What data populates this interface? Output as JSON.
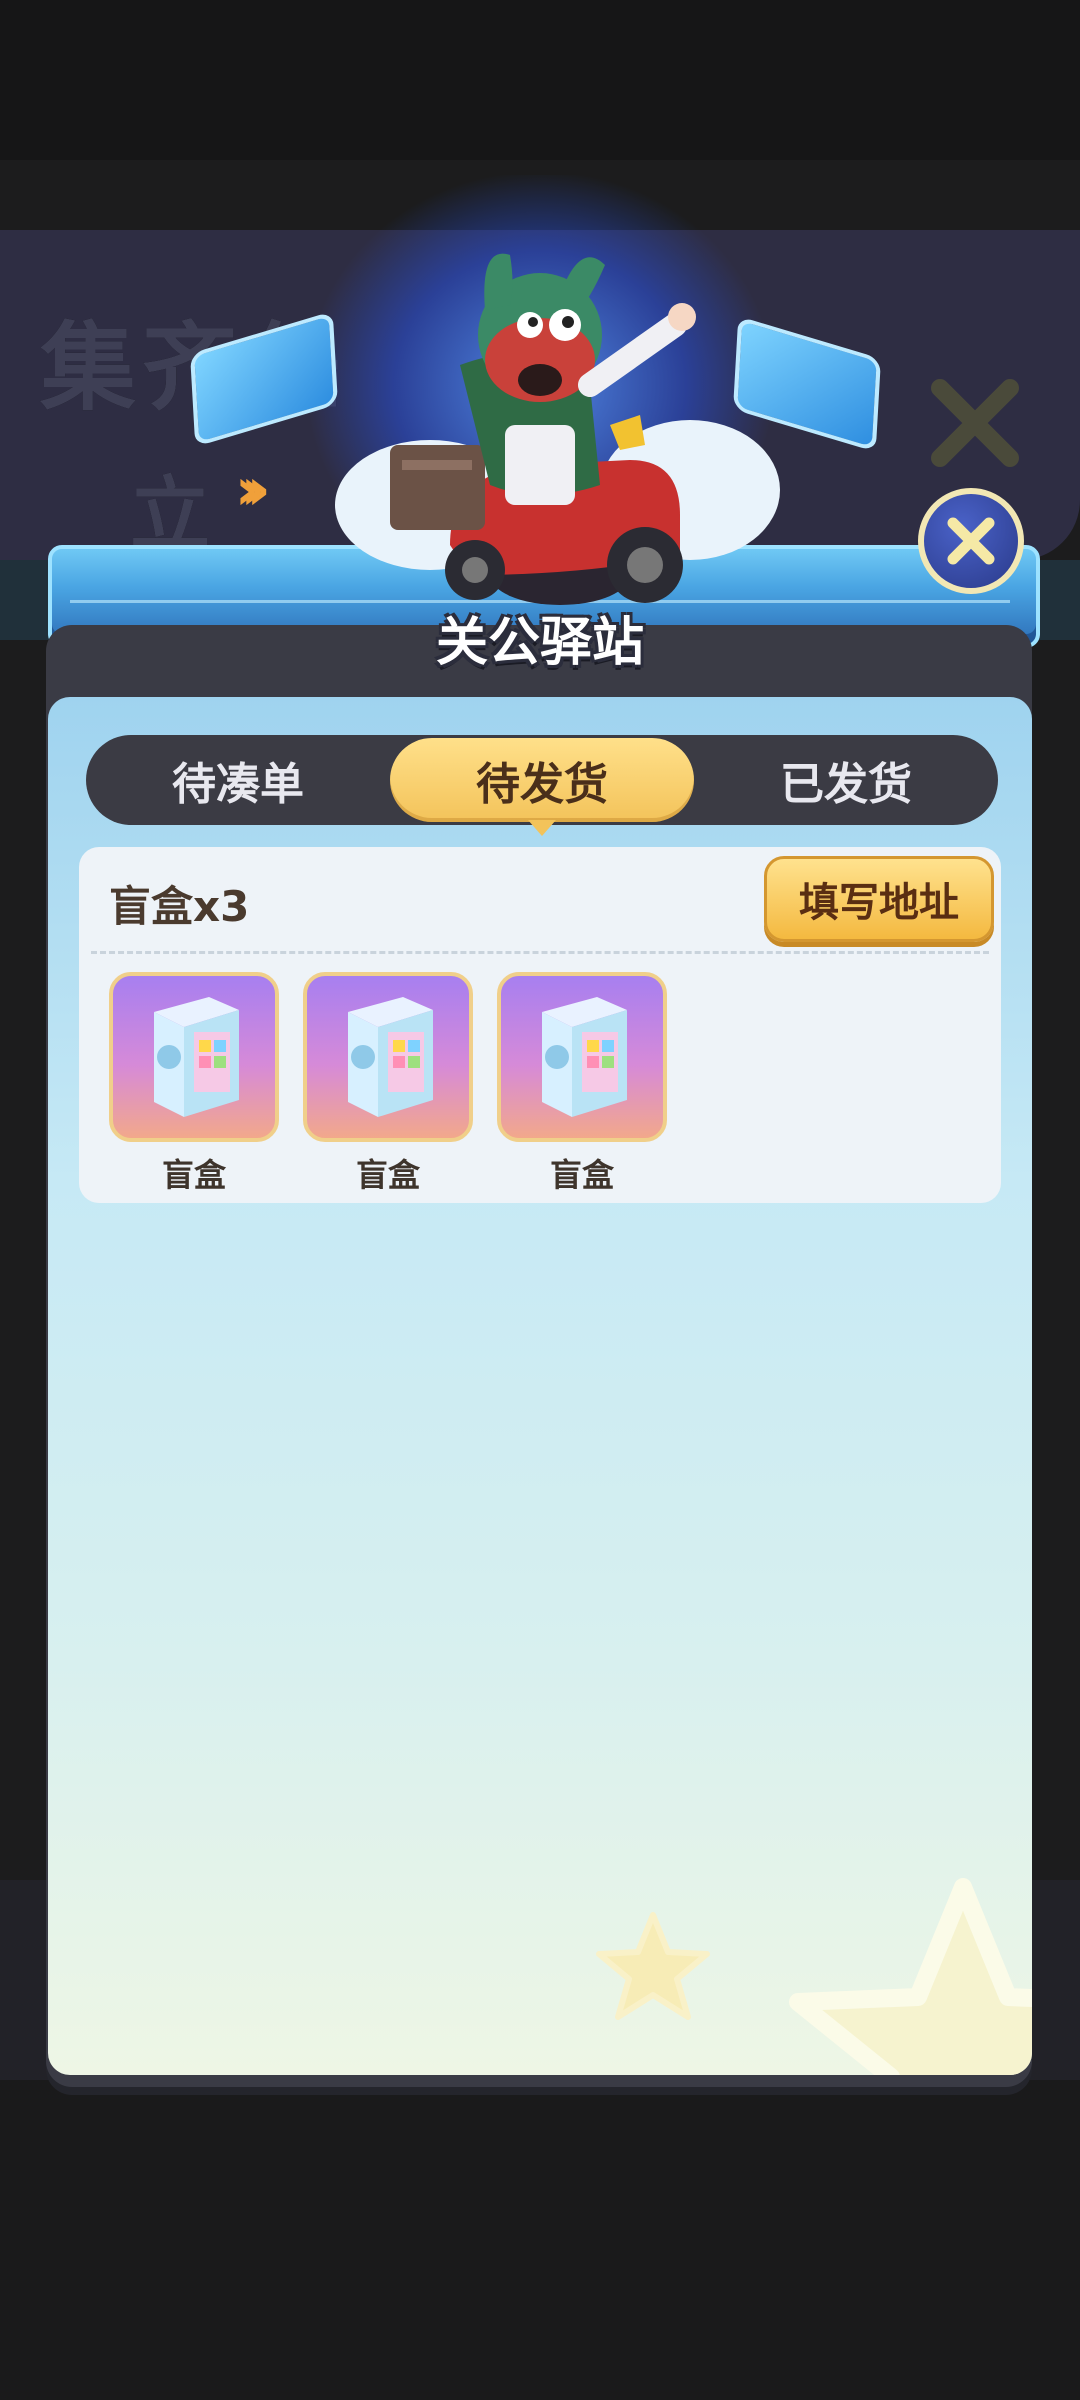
{
  "header": {
    "title": "关公驿站",
    "bg_text_1": "集齐任",
    "bg_text_2": "立"
  },
  "tabs": [
    {
      "label": "待凑单",
      "active": false
    },
    {
      "label": "待发货",
      "active": true
    },
    {
      "label": "已发货",
      "active": false
    }
  ],
  "order": {
    "title": "盲盒x3",
    "action_label": "填写地址",
    "items": [
      {
        "label": "盲盒",
        "icon": "blind-box-icon"
      },
      {
        "label": "盲盒",
        "icon": "blind-box-icon"
      },
      {
        "label": "盲盒",
        "icon": "blind-box-icon"
      }
    ]
  },
  "colors": {
    "accent": "#f3c35a",
    "panel": "#3a3b45",
    "panel_gradient_top": "#9fd3ef",
    "text_dark": "#4a3a2e"
  }
}
